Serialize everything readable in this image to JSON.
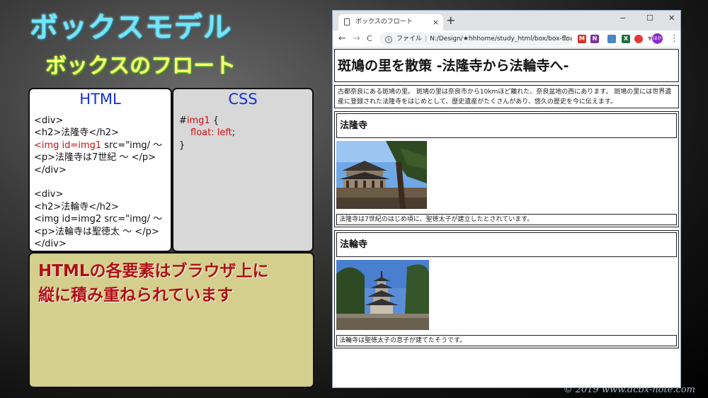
{
  "slide": {
    "title": "ボックスモデル",
    "subtitle": "ボックスのフロート"
  },
  "html_panel": {
    "heading": "HTML",
    "lines": [
      "<div>",
      "<h2>法隆寺</h2>",
      "<img id=img1 src=\"img/ ～",
      "<p>法隆寺は7世紀 ～ </p>",
      "</div>",
      "",
      "<div>",
      "<h2>法輪寺</h2>",
      "<img id=img2 src=\"img/ ～",
      "<p>法輪寺は聖徳太 ～ </p>",
      "</div>"
    ]
  },
  "css_panel": {
    "heading": "CSS",
    "selector_hash": "#",
    "selector_name": "img1",
    "open_brace": " {",
    "property": "float: left",
    "semicolon": ";",
    "close_brace": "}"
  },
  "note": {
    "line1": "HTMLの各要素はブラウザ上に",
    "line2": "縦に積み重ねられています"
  },
  "browser": {
    "tab_title": "ボックスのフロート",
    "tab_close": "×",
    "new_tab": "+",
    "minimize": "−",
    "maximize": "☐",
    "close": "✕",
    "back": "←",
    "forward": "→",
    "reload": "C",
    "address_label": "ファイル",
    "address_url": "N:/Design/★hhhome/study_html/box/box-float/...",
    "star": "☆",
    "avatar_text": "ほか",
    "menu": "⋮",
    "page": {
      "h1": "斑鳩の里を散策 -法隆寺から法輪寺へ-",
      "intro": "古都奈良にある斑鳩の里。 斑鳩の里は奈良市から10kmほど離れた、奈良盆地の西にあります。 斑鳩の里には世界遺産に登録された法隆寺をはじめとして、歴史遺産がたくさんがあり、悠久の歴史を今に伝えます。",
      "sections": [
        {
          "h2": "法隆寺",
          "caption": "法隆寺は7世紀のはじめ頃に、聖徳太子が建立したとされています。"
        },
        {
          "h2": "法輪寺",
          "caption": "法輪寺は聖徳太子の息子が建てたそうです。"
        }
      ]
    }
  },
  "copyright": "© 2019 www.dcbx-note.com"
}
